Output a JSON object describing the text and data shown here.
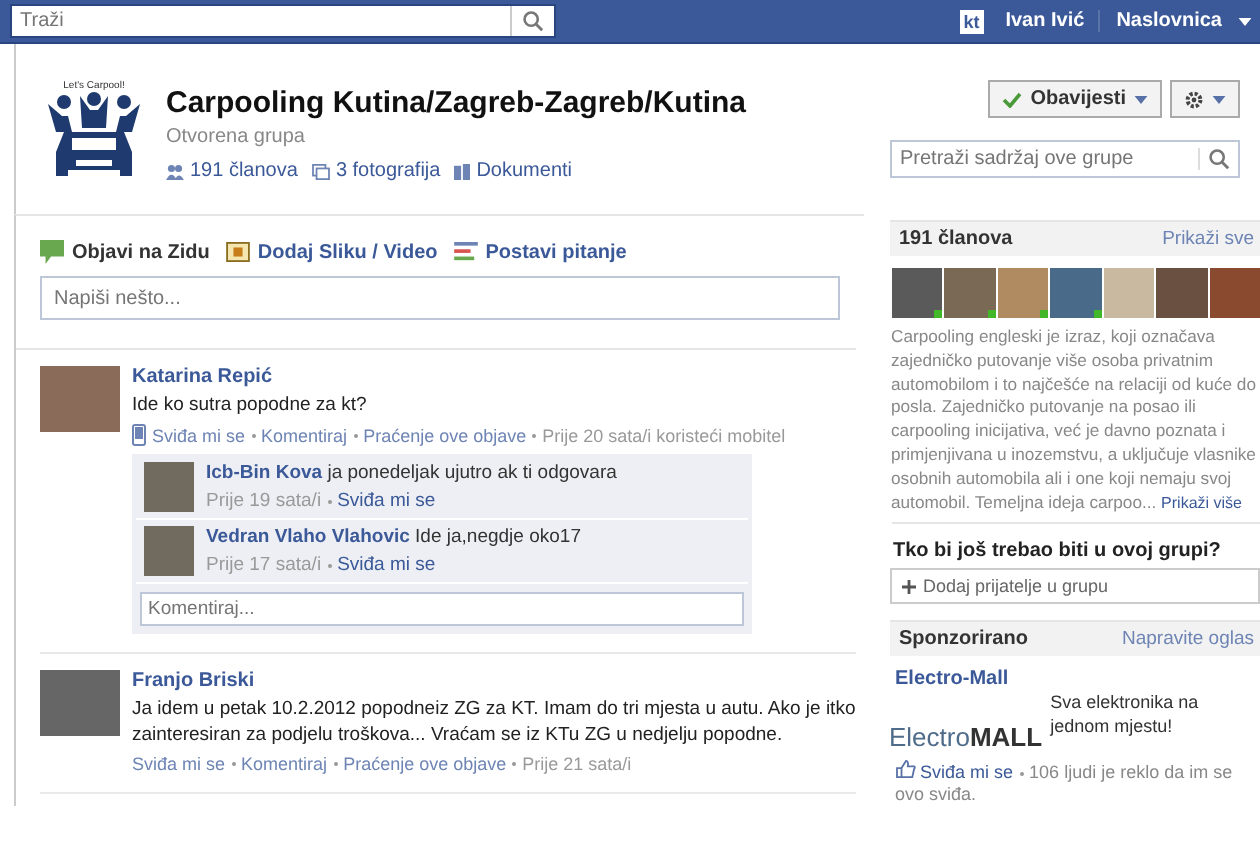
{
  "topbar": {
    "search_placeholder": "Traži",
    "app_badge": "kt",
    "user": "Ivan Ivić",
    "home": "Naslovnica"
  },
  "group": {
    "logo_caption": "Let's Carpool!",
    "title": "Carpooling Kutina/Zagreb-Zagreb/Kutina",
    "type": "Otvorena grupa",
    "links": [
      {
        "kind": "members",
        "label": "191 članova"
      },
      {
        "kind": "photos",
        "label": "3 fotografija"
      },
      {
        "kind": "docs",
        "label": "Dokumenti"
      }
    ],
    "notify_button": "Obavijesti",
    "search_placeholder": "Pretraži sadržaj ove grupe"
  },
  "composer": {
    "tabs": [
      {
        "kind": "status",
        "label": "Objavi na Zidu",
        "selected": true
      },
      {
        "kind": "photo",
        "label": "Dodaj Sliku / Video",
        "selected": false
      },
      {
        "kind": "question",
        "label": "Postavi pitanje",
        "selected": false
      }
    ],
    "placeholder": "Napiši nešto..."
  },
  "posts": [
    {
      "author": "Katarina Repić",
      "text": "Ide ko sutra popodne za kt?",
      "mobile": true,
      "actions": [
        "Sviđa mi se",
        "Komentiraj",
        "Praćenje ove objave"
      ],
      "time": "Prije 20 sata/i koristeći mobitel",
      "comments": [
        {
          "author": "Icb-Bin Kova",
          "text": "ja ponedeljak ujutro ak ti odgovara",
          "time": "Prije 19 sata/i",
          "like": "Sviđa mi se"
        },
        {
          "author": "Vedran Vlaho Vlahovic",
          "text": "Ide ja,negdje oko17",
          "time": "Prije 17 sata/i",
          "like": "Sviđa mi se"
        }
      ],
      "comment_placeholder": "Komentiraj..."
    },
    {
      "author": "Franjo Briski",
      "text": "Ja idem u petak 10.2.2012 popodneiz ZG za KT. Imam do tri mjesta u autu. Ako je itko zainteresiran za podjelu troškova... Vraćam se iz KTu ZG u nedjelju popodne.",
      "mobile": false,
      "actions": [
        "Sviđa mi se",
        "Komentiraj",
        "Praćenje ove objave"
      ],
      "time": "Prije 21 sata/i"
    }
  ],
  "sidebar": {
    "members": {
      "title": "191 članova",
      "show_all": "Prikaži sve",
      "photos": [
        {
          "online": true
        },
        {
          "online": true
        },
        {
          "online": true
        },
        {
          "online": true
        },
        {
          "online": false
        },
        {
          "online": false
        },
        {
          "online": false
        }
      ],
      "description": "Carpooling engleski je izraz, koji označava zajedničko putovanje više osoba privatnim automobilom i to najčešće na relaciji od kuće do posla. Zajedničko putovanje na posao ili carpooling inicijativa, već je davno poznata i primjenjivana u inozemstvu, a uključuje vlasnike osobnih automobila ali i one koji nemaju svoj automobil. Temeljna ideja carpoo...",
      "show_more": "Prikaži više"
    },
    "invite": {
      "title": "Tko bi još trebao biti u ovoj grupi?",
      "placeholder": "Dodaj prijatelje u grupu"
    },
    "sponsored": {
      "title": "Sponzorirano",
      "create_ad": "Napravite oglas",
      "advertiser": "Electro-Mall",
      "logo_light": "Electro",
      "logo_bold": "MALL",
      "ad_text": "Sva elektronika na jednom mjestu!",
      "like": "Sviđa mi se",
      "likes_text": "106 ljudi je reklo da im se ovo sviđa."
    }
  }
}
